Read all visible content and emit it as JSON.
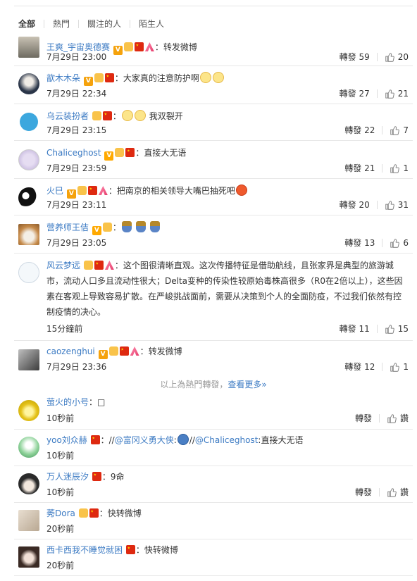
{
  "tabs": [
    "全部",
    "熱門",
    "關注的人",
    "陌生人"
  ],
  "hot_comments": [
    {
      "user": "王爽_宇宙奥德赛",
      "colon": "：",
      "text": "转发微博",
      "time": "7月29日 23:00",
      "repost_label": "轉發",
      "repost_count": "59",
      "like_count": "20"
    },
    {
      "user": "歆木木朵",
      "colon": "：",
      "text": "大家真的注意防护啊",
      "time": "7月29日 22:34",
      "repost_label": "轉發",
      "repost_count": "27",
      "like_count": "21"
    },
    {
      "user": "乌云装扮者",
      "colon": "：",
      "text": "我双裂开",
      "time": "7月29日 23:15",
      "repost_label": "轉發",
      "repost_count": "22",
      "like_count": "7"
    },
    {
      "user": "Chaliceghost",
      "colon": "：",
      "text": "直接大无语",
      "time": "7月29日 23:59",
      "repost_label": "轉發",
      "repost_count": "21",
      "like_count": "1"
    },
    {
      "user": "火巳",
      "colon": "：",
      "text": "把南京的相关领导大嘴巴抽死吧",
      "time": "7月29日 23:11",
      "repost_label": "轉發",
      "repost_count": "20",
      "like_count": "31"
    },
    {
      "user": "营养师王佶",
      "colon": "：",
      "text": "",
      "time": "7月29日 23:05",
      "repost_label": "轉發",
      "repost_count": "13",
      "like_count": "6"
    },
    {
      "user": "风云梦远",
      "colon": "：",
      "text": "这个图很清晰直观。这次传播特征是借助航线，且张家界是典型的旅游城市，流动人口多且流动性很大；Delta变种的传染性较原始毒株高很多（R0在2倍以上），这些因素在客观上导致容易扩散。在严峻挑战面前，需要从决策到个人的全面防疫，不过我们依然有控制疫情的决心。",
      "time": "15分鐘前",
      "repost_label": "轉發",
      "repost_count": "11",
      "like_count": "15"
    },
    {
      "user": "caozenghui",
      "colon": "：",
      "text": "转发微博",
      "time": "7月29日 23:36",
      "repost_label": "轉發",
      "repost_count": "12",
      "like_count": "1"
    }
  ],
  "divider": {
    "text": "以上為熱門轉發，",
    "link": "查看更多»"
  },
  "recent_comments": [
    {
      "user": "萤火的小号",
      "colon": "：",
      "text": "□",
      "time": "10秒前",
      "repost_label": "轉發",
      "like_label": "讚"
    },
    {
      "user": "yoo刘众赫",
      "colon": "：",
      "text_pre": "//",
      "mention1": "@富冈义勇大侠",
      "text_mid": ":",
      "text_mid2": "//",
      "mention2": "@Chaliceghost",
      "text_post": ":直接大无语",
      "time": "10秒前"
    },
    {
      "user": "万人迷辰汐",
      "colon": "：",
      "text": "9命",
      "time": "10秒前",
      "repost_label": "轉發",
      "like_label": "讚"
    },
    {
      "user": "莠Dora",
      "colon": "：",
      "text": "快转微博",
      "time": "20秒前"
    },
    {
      "user": "西卡西我不睡觉就困",
      "colon": "：",
      "text": "快转微博",
      "time": "20秒前"
    }
  ]
}
